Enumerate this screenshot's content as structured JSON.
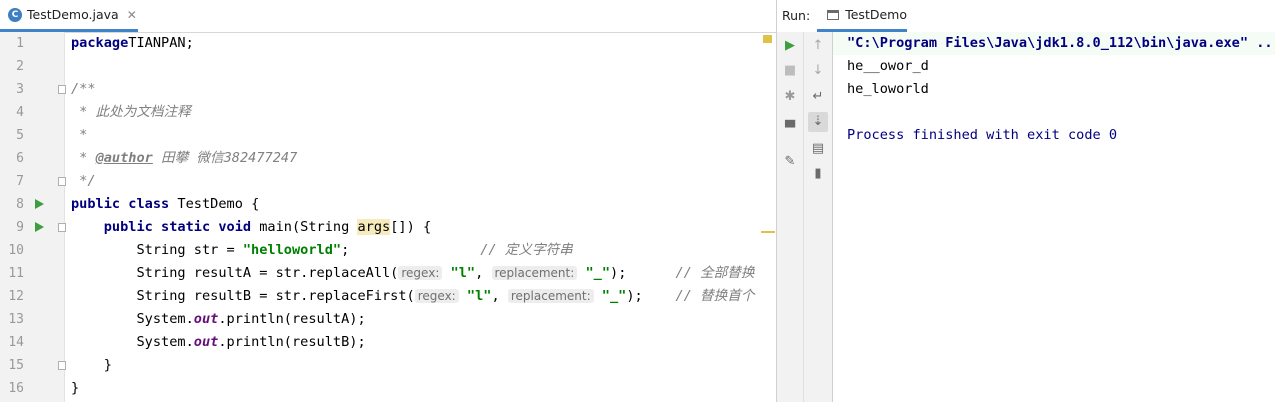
{
  "editor": {
    "tab_label": "TestDemo.java",
    "tab_close": "✕",
    "lines": [
      {
        "n": "1",
        "segs": [
          [
            "kw",
            "package"
          ],
          [
            "",
            "TIANPAN;"
          ]
        ]
      },
      {
        "n": "2",
        "segs": []
      },
      {
        "n": "3",
        "segs": [
          [
            "doc",
            "/**"
          ]
        ]
      },
      {
        "n": "4",
        "segs": [
          [
            "doc",
            " * 此处为文档注释"
          ]
        ]
      },
      {
        "n": "5",
        "segs": [
          [
            "doc",
            " *"
          ]
        ]
      },
      {
        "n": "6",
        "segs": [
          [
            "doc",
            " * "
          ],
          [
            "tag",
            "@author"
          ],
          [
            "doc",
            " 田攀 微信382477247"
          ]
        ]
      },
      {
        "n": "7",
        "segs": [
          [
            "doc",
            " */"
          ]
        ]
      },
      {
        "n": "8",
        "segs": [
          [
            "kw",
            "public class "
          ],
          [
            "",
            "TestDemo {"
          ]
        ]
      },
      {
        "n": "9",
        "segs": [
          [
            "",
            "    "
          ],
          [
            "kw",
            "public static void "
          ],
          [
            "",
            "main(String "
          ],
          [
            "hl",
            "args"
          ],
          [
            "",
            "[]) {"
          ]
        ]
      },
      {
        "n": "10",
        "segs": [
          [
            "",
            "        String str = "
          ],
          [
            "str",
            "\"helloworld\""
          ],
          [
            "",
            ";                "
          ],
          [
            "cmt",
            "// 定义字符串"
          ]
        ]
      },
      {
        "n": "11",
        "segs": [
          [
            "",
            "        String resultA = str.replaceAll("
          ],
          [
            "hint",
            "regex:"
          ],
          [
            "str",
            " \"l\""
          ],
          [
            "",
            ", "
          ],
          [
            "hint",
            "replacement:"
          ],
          [
            "str",
            " \"_\""
          ],
          [
            "",
            ");      "
          ],
          [
            "cmt",
            "// 全部替换"
          ]
        ]
      },
      {
        "n": "12",
        "segs": [
          [
            "",
            "        String resultB = str.replaceFirst("
          ],
          [
            "hint",
            "regex:"
          ],
          [
            "str",
            " \"l\""
          ],
          [
            "",
            ", "
          ],
          [
            "hint",
            "replacement:"
          ],
          [
            "str",
            " \"_\""
          ],
          [
            "",
            ");    "
          ],
          [
            "cmt",
            "// 替换首个"
          ]
        ]
      },
      {
        "n": "13",
        "segs": [
          [
            "",
            "        System."
          ],
          [
            "field",
            "out"
          ],
          [
            "",
            ".println(resultA);"
          ]
        ]
      },
      {
        "n": "14",
        "segs": [
          [
            "",
            "        System."
          ],
          [
            "field",
            "out"
          ],
          [
            "",
            ".println(resultB);"
          ]
        ]
      },
      {
        "n": "15",
        "segs": [
          [
            "",
            "    }"
          ]
        ]
      },
      {
        "n": "16",
        "segs": [
          [
            "",
            "}"
          ]
        ]
      }
    ]
  },
  "run": {
    "label": "Run:",
    "tab_label": "TestDemo",
    "console": [
      "\"C:\\Program Files\\Java\\jdk1.8.0_112\\bin\\java.exe\" ...",
      "he__owor_d",
      "he_loworld",
      "",
      "Process finished with exit code 0"
    ]
  },
  "colors": {
    "accent": "#4083c9",
    "run_green": "#3e9d3e",
    "keyword": "#000080",
    "string": "#008000"
  }
}
